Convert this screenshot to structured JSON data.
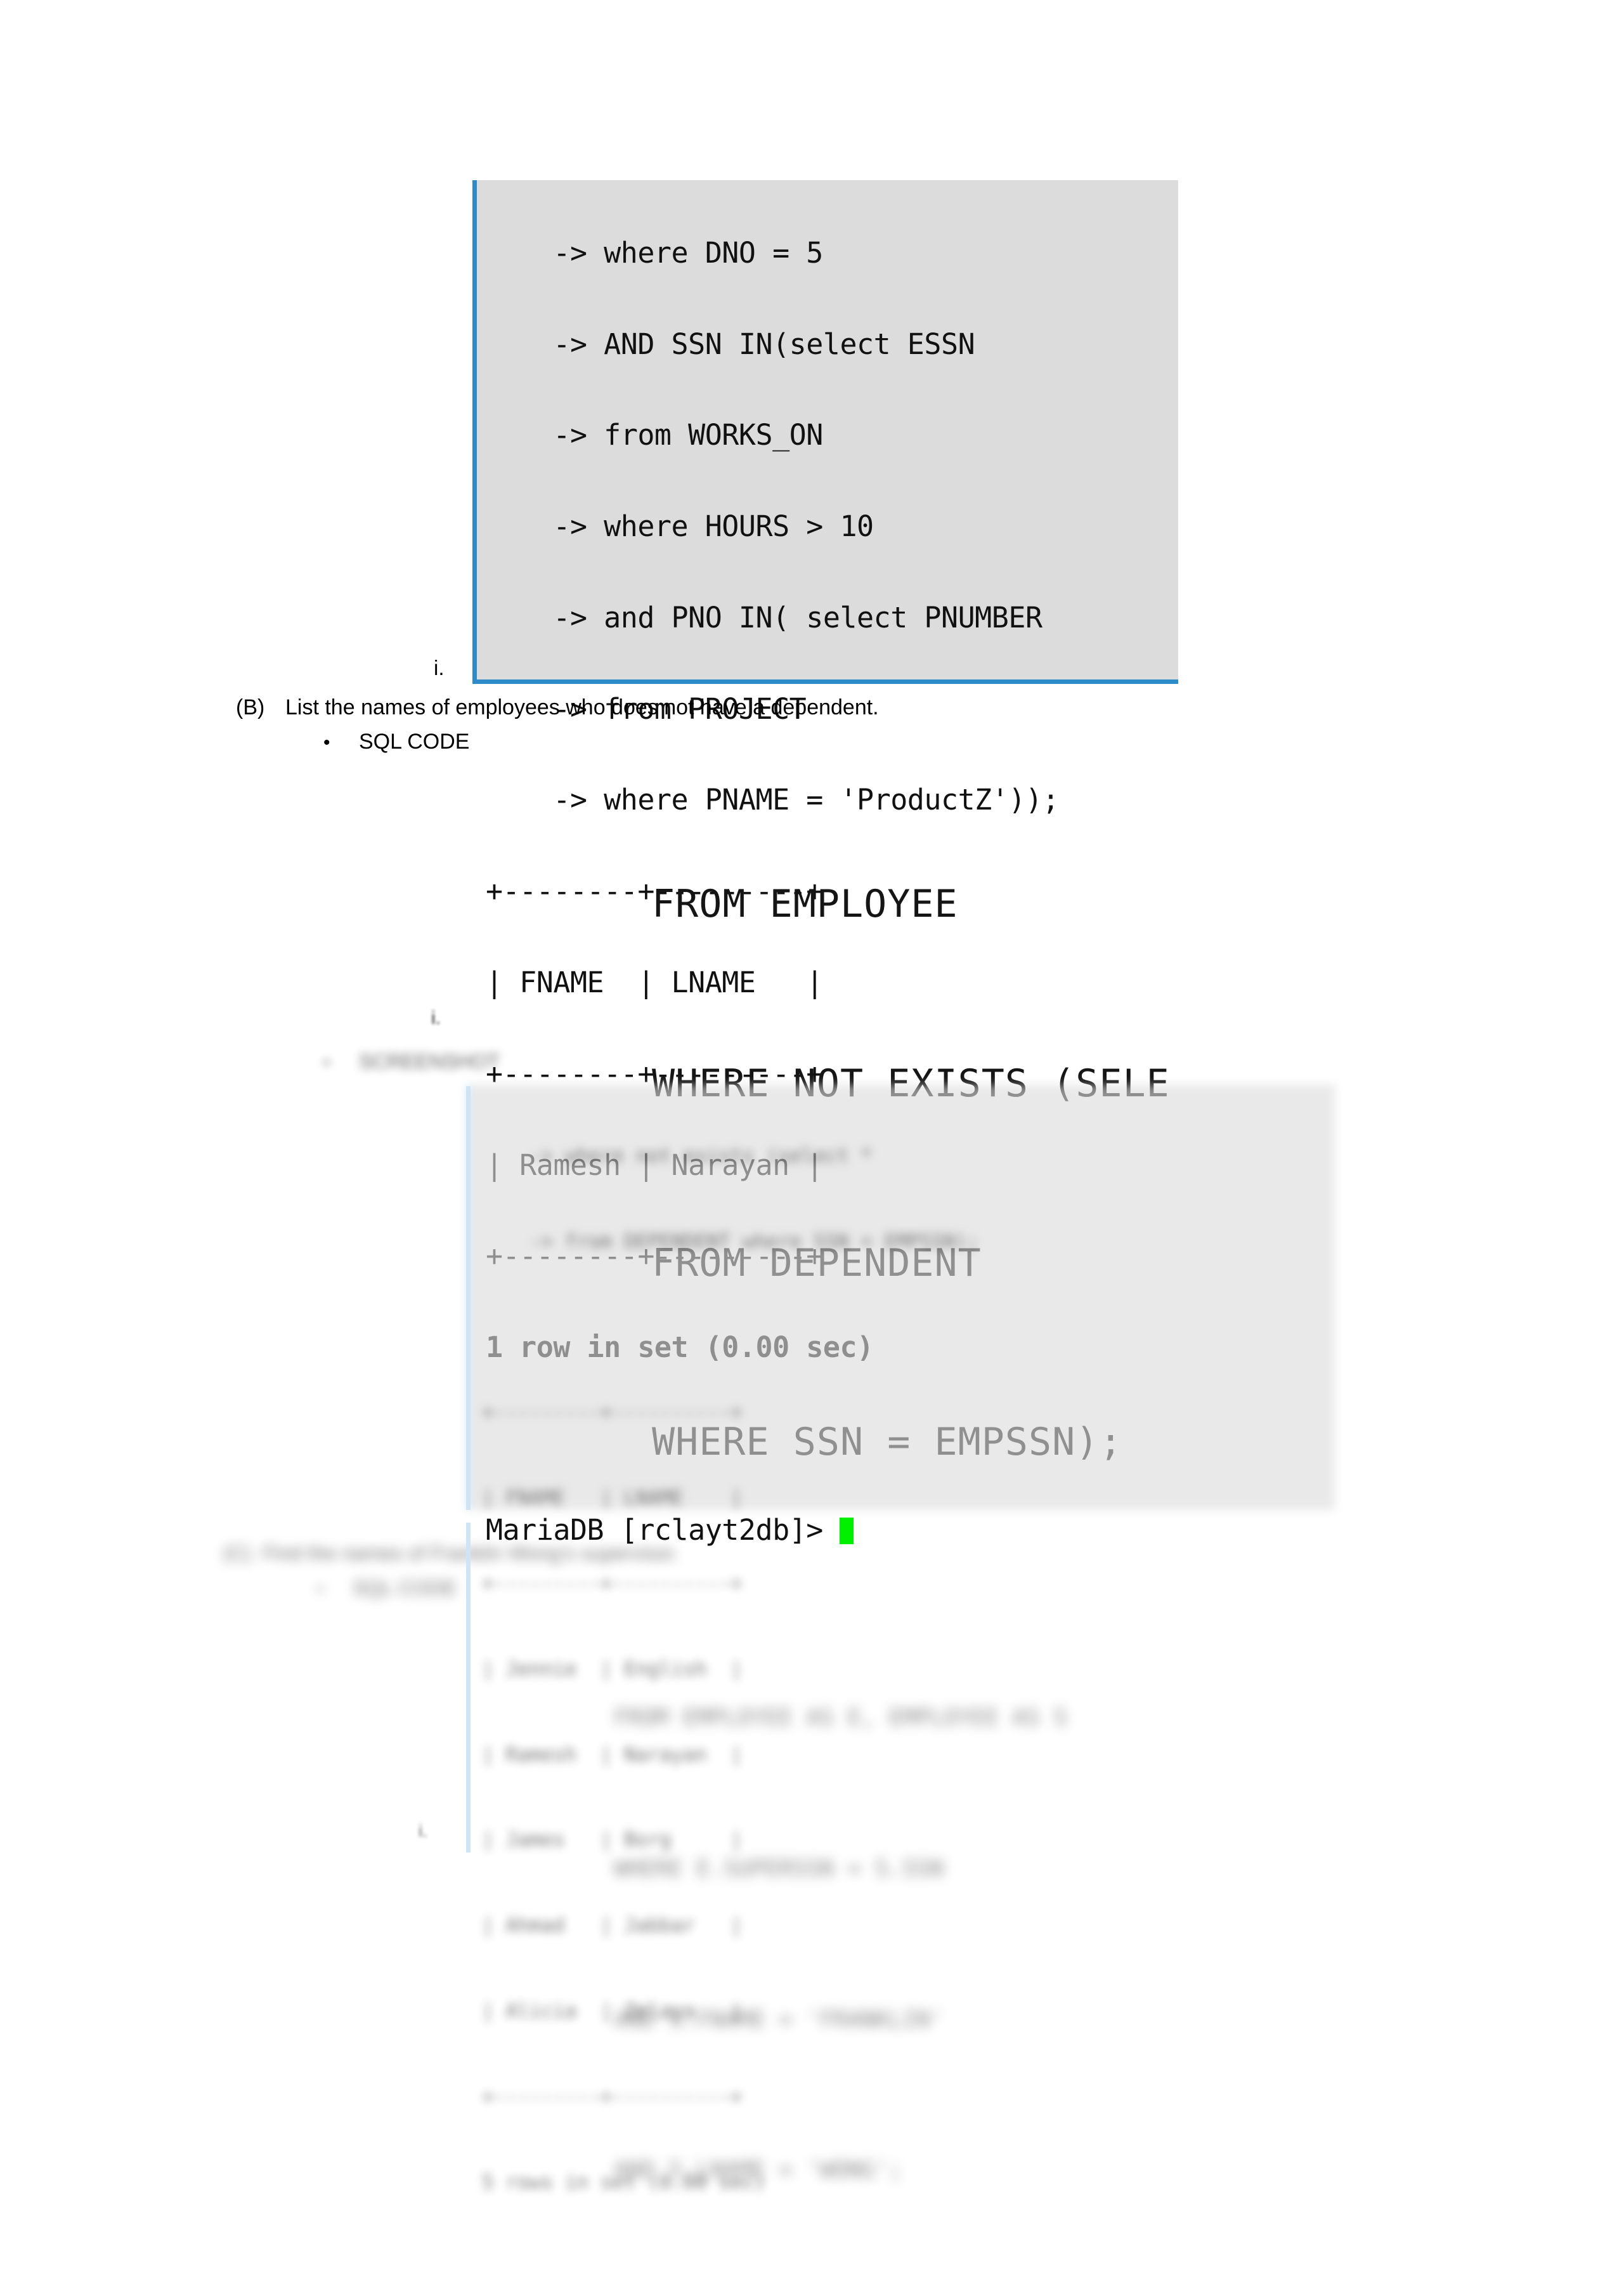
{
  "document": {
    "page_background": "#ffffff",
    "accent_blue": "#2e8bc9",
    "terminal_bg": "#dcdcdc",
    "cursor_color": "#00f000"
  },
  "terminal_top": {
    "lines": [
      "    -> where DNO = 5",
      "    -> AND SSN IN(select ESSN",
      "    -> from WORKS_ON",
      "    -> where HOURS > 10",
      "    -> and PNO IN( select PNUMBER",
      "    -> from PROJECT",
      "    -> where PNAME = 'ProductZ'));"
    ],
    "table": {
      "rule": "+--------+---------+",
      "header_row": "| FNAME  | LNAME   |",
      "columns": [
        "FNAME",
        "LNAME"
      ],
      "rows": [
        [
          "Ramesh",
          "Narayan"
        ]
      ],
      "data_row": "| Ramesh | Narayan |"
    },
    "status": "1 row in set (0.00 sec)",
    "prompt": "MariaDB [rclayt2db]>",
    "cursor": "block-cursor"
  },
  "markers": {
    "roman_i_first": "i.",
    "roman_i_second": "i.",
    "roman_i_third": "i."
  },
  "question_b": {
    "label": "(B)",
    "text": "List the names of employees who does not have a dependent.",
    "bullet": "•",
    "bullet_label": "SQL CODE"
  },
  "sql_code_b": {
    "lines": [
      "FROM EMPLOYEE",
      "WHERE NOT EXISTS (SELE",
      "FROM DEPENDENT",
      "WHERE SSN = EMPSSN);"
    ]
  },
  "output_b": {
    "bullet": "•",
    "bullet_label": "SCREENSHOT",
    "terminal_lines": [
      "    -> where not exists (select *",
      "    -> from DEPENDENT where SSN = EMPSSN);"
    ],
    "table": {
      "rule": "+---------+----------+",
      "header_row": "| FNAME   | LNAME    |",
      "columns": [
        "FNAME",
        "LNAME"
      ],
      "rows": [
        [
          "Jennie",
          "English"
        ],
        [
          "Ramesh",
          "Narayan"
        ],
        [
          "James",
          "Borg"
        ],
        [
          "Ahmad",
          "Jabbar"
        ],
        [
          "Alicia",
          "Zelaya"
        ]
      ]
    },
    "status": "5 rows in set (0.00 sec)"
  },
  "question_c": {
    "label": "(C)",
    "text": "Find the names of Franklin Wong's supervisor.",
    "bullet": "•",
    "bullet_label": "SQL CODE"
  },
  "sql_code_c": {
    "lines": [
      "FROM EMPLOYEE AS E, EMPLOYEE AS S",
      "WHERE E.SUPERSSN = S.SSN",
      "AND S.FNAME = 'FRANKLIN'",
      "AND S.LNAME = 'WONG';"
    ]
  }
}
